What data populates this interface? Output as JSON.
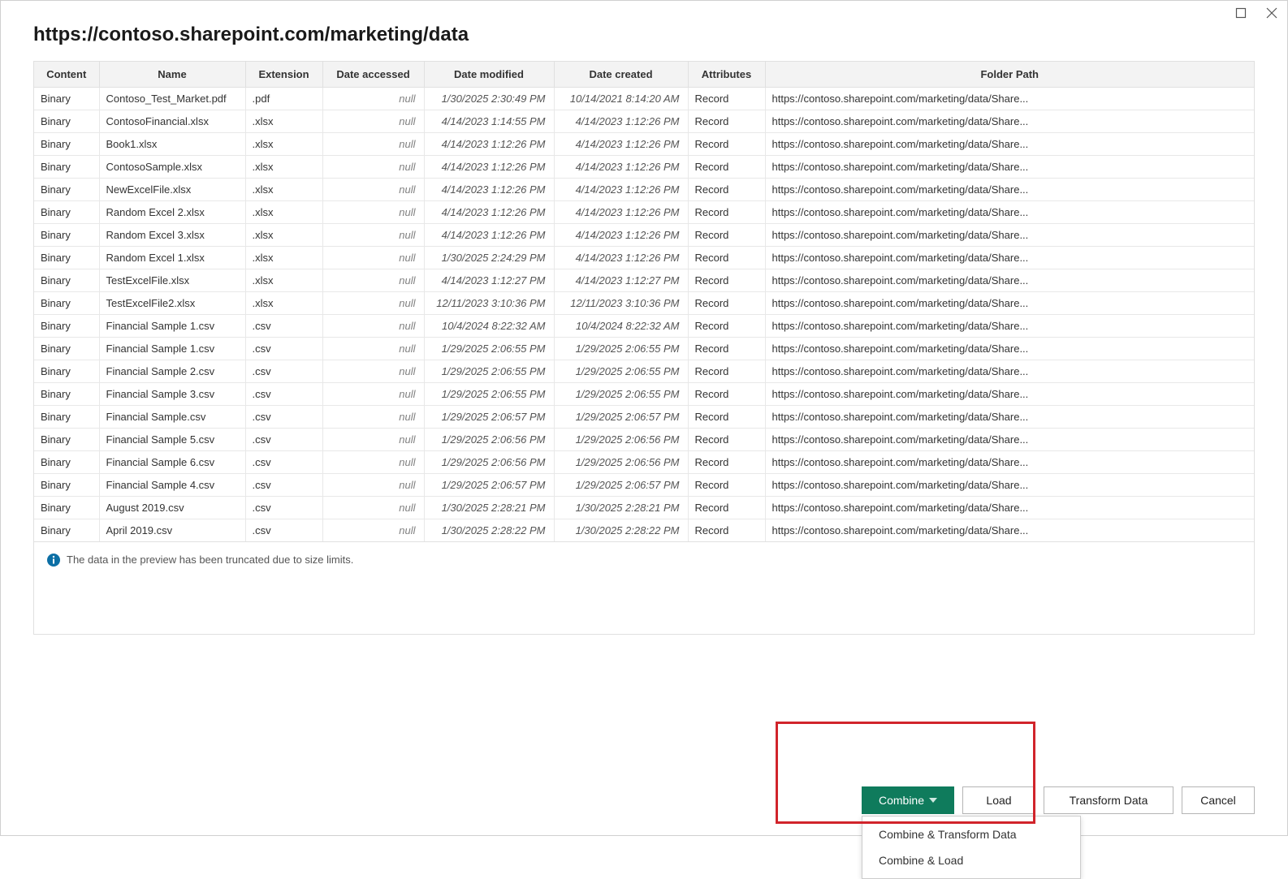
{
  "title": "https://contoso.sharepoint.com/marketing/data",
  "columns": [
    "Content",
    "Name",
    "Extension",
    "Date accessed",
    "Date modified",
    "Date created",
    "Attributes",
    "Folder Path"
  ],
  "truncated_path": "https://contoso.sharepoint.com/marketing/data/Share...",
  "rows": [
    {
      "content": "Binary",
      "name": "Contoso_Test_Market.pdf",
      "ext": ".pdf",
      "accessed": "null",
      "modified": "1/30/2025 2:30:49 PM",
      "created": "10/14/2021 8:14:20 AM",
      "attr": "Record"
    },
    {
      "content": "Binary",
      "name": "ContosoFinancial.xlsx",
      "ext": ".xlsx",
      "accessed": "null",
      "modified": "4/14/2023 1:14:55 PM",
      "created": "4/14/2023 1:12:26 PM",
      "attr": "Record"
    },
    {
      "content": "Binary",
      "name": "Book1.xlsx",
      "ext": ".xlsx",
      "accessed": "null",
      "modified": "4/14/2023 1:12:26 PM",
      "created": "4/14/2023 1:12:26 PM",
      "attr": "Record"
    },
    {
      "content": "Binary",
      "name": "ContosoSample.xlsx",
      "ext": ".xlsx",
      "accessed": "null",
      "modified": "4/14/2023 1:12:26 PM",
      "created": "4/14/2023 1:12:26 PM",
      "attr": "Record"
    },
    {
      "content": "Binary",
      "name": "NewExcelFile.xlsx",
      "ext": ".xlsx",
      "accessed": "null",
      "modified": "4/14/2023 1:12:26 PM",
      "created": "4/14/2023 1:12:26 PM",
      "attr": "Record"
    },
    {
      "content": "Binary",
      "name": "Random Excel 2.xlsx",
      "ext": ".xlsx",
      "accessed": "null",
      "modified": "4/14/2023 1:12:26 PM",
      "created": "4/14/2023 1:12:26 PM",
      "attr": "Record"
    },
    {
      "content": "Binary",
      "name": "Random Excel 3.xlsx",
      "ext": ".xlsx",
      "accessed": "null",
      "modified": "4/14/2023 1:12:26 PM",
      "created": "4/14/2023 1:12:26 PM",
      "attr": "Record"
    },
    {
      "content": "Binary",
      "name": "Random Excel 1.xlsx",
      "ext": ".xlsx",
      "accessed": "null",
      "modified": "1/30/2025 2:24:29 PM",
      "created": "4/14/2023 1:12:26 PM",
      "attr": "Record"
    },
    {
      "content": "Binary",
      "name": "TestExcelFile.xlsx",
      "ext": ".xlsx",
      "accessed": "null",
      "modified": "4/14/2023 1:12:27 PM",
      "created": "4/14/2023 1:12:27 PM",
      "attr": "Record"
    },
    {
      "content": "Binary",
      "name": "TestExcelFile2.xlsx",
      "ext": ".xlsx",
      "accessed": "null",
      "modified": "12/11/2023 3:10:36 PM",
      "created": "12/11/2023 3:10:36 PM",
      "attr": "Record"
    },
    {
      "content": "Binary",
      "name": "Financial Sample 1.csv",
      "ext": ".csv",
      "accessed": "null",
      "modified": "10/4/2024 8:22:32 AM",
      "created": "10/4/2024 8:22:32 AM",
      "attr": "Record"
    },
    {
      "content": "Binary",
      "name": "Financial Sample 1.csv",
      "ext": ".csv",
      "accessed": "null",
      "modified": "1/29/2025 2:06:55 PM",
      "created": "1/29/2025 2:06:55 PM",
      "attr": "Record"
    },
    {
      "content": "Binary",
      "name": "Financial Sample 2.csv",
      "ext": ".csv",
      "accessed": "null",
      "modified": "1/29/2025 2:06:55 PM",
      "created": "1/29/2025 2:06:55 PM",
      "attr": "Record"
    },
    {
      "content": "Binary",
      "name": "Financial Sample 3.csv",
      "ext": ".csv",
      "accessed": "null",
      "modified": "1/29/2025 2:06:55 PM",
      "created": "1/29/2025 2:06:55 PM",
      "attr": "Record"
    },
    {
      "content": "Binary",
      "name": "Financial Sample.csv",
      "ext": ".csv",
      "accessed": "null",
      "modified": "1/29/2025 2:06:57 PM",
      "created": "1/29/2025 2:06:57 PM",
      "attr": "Record"
    },
    {
      "content": "Binary",
      "name": "Financial Sample 5.csv",
      "ext": ".csv",
      "accessed": "null",
      "modified": "1/29/2025 2:06:56 PM",
      "created": "1/29/2025 2:06:56 PM",
      "attr": "Record"
    },
    {
      "content": "Binary",
      "name": "Financial Sample 6.csv",
      "ext": ".csv",
      "accessed": "null",
      "modified": "1/29/2025 2:06:56 PM",
      "created": "1/29/2025 2:06:56 PM",
      "attr": "Record"
    },
    {
      "content": "Binary",
      "name": "Financial Sample 4.csv",
      "ext": ".csv",
      "accessed": "null",
      "modified": "1/29/2025 2:06:57 PM",
      "created": "1/29/2025 2:06:57 PM",
      "attr": "Record"
    },
    {
      "content": "Binary",
      "name": "August 2019.csv",
      "ext": ".csv",
      "accessed": "null",
      "modified": "1/30/2025 2:28:21 PM",
      "created": "1/30/2025 2:28:21 PM",
      "attr": "Record"
    },
    {
      "content": "Binary",
      "name": "April 2019.csv",
      "ext": ".csv",
      "accessed": "null",
      "modified": "1/30/2025 2:28:22 PM",
      "created": "1/30/2025 2:28:22 PM",
      "attr": "Record"
    }
  ],
  "info_message": "The data in the preview has been truncated due to size limits.",
  "buttons": {
    "combine": "Combine",
    "load": "Load",
    "transform": "Transform Data",
    "cancel": "Cancel"
  },
  "dropdown": {
    "item1": "Combine & Transform Data",
    "item2": "Combine & Load"
  }
}
